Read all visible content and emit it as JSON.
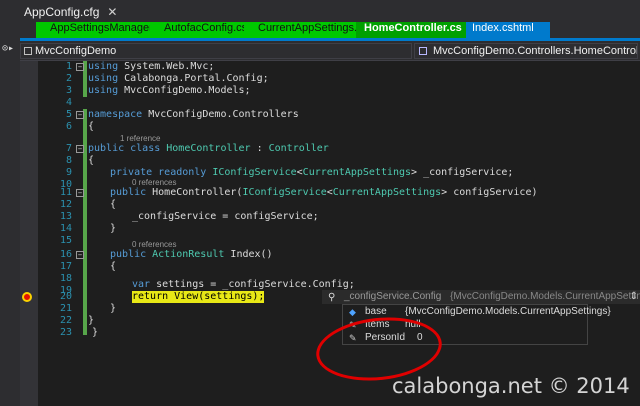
{
  "window": {
    "tab": "AppConfig.cfg",
    "tab_close": "✕"
  },
  "tabs": [
    {
      "label": "AppSettingsManager.cs"
    },
    {
      "label": "AutofacConfig.cs"
    },
    {
      "label": "CurrentAppSettings.cs"
    },
    {
      "label": "HomeController.cs",
      "close": "✕"
    },
    {
      "label": "Index.cshtml"
    }
  ],
  "nav": {
    "project": "MvcConfigDemo",
    "member": "MvcConfigDemo.Controllers.HomeController"
  },
  "code_lines": [
    {
      "n": "1"
    },
    {
      "n": "2"
    },
    {
      "n": "3"
    },
    {
      "n": "4"
    },
    {
      "n": "5"
    },
    {
      "n": "6"
    },
    {
      "n": "7"
    },
    {
      "n": "8"
    },
    {
      "n": "9"
    },
    {
      "n": "10"
    },
    {
      "n": "11"
    },
    {
      "n": "12"
    },
    {
      "n": "13"
    },
    {
      "n": "14"
    },
    {
      "n": "15"
    },
    {
      "n": "16"
    },
    {
      "n": "17"
    },
    {
      "n": "18"
    },
    {
      "n": "19"
    },
    {
      "n": "20"
    },
    {
      "n": "21"
    },
    {
      "n": "22"
    },
    {
      "n": "23"
    }
  ],
  "code": {
    "l1a": "using",
    "l1b": " System.Web.Mvc;",
    "l2a": "using",
    "l2b": " Calabonga.Portal.Config;",
    "l3a": "using",
    "l3b": " MvcConfigDemo.Models;",
    "l5a": "namespace",
    "l5b": " MvcConfigDemo.Controllers",
    "brace_open": "{",
    "brace_close": "}",
    "ref1": "1 reference",
    "l7a": "public class",
    "l7b": " HomeController",
    "l7c": " : ",
    "l7d": "Controller",
    "l9a": "private readonly",
    "l9b": " IConfigService",
    "l9c": "<",
    "l9d": "CurrentAppSettings",
    "l9e": "> _configService;",
    "ref0a": "0 references",
    "l11a": "public",
    "l11b": " HomeController(",
    "l11c": "IConfigService",
    "l11d": "<",
    "l11e": "CurrentAppSettings",
    "l11f": "> configService)",
    "l13": "_configService = configService;",
    "ref0b": "0 references",
    "l16a": "public",
    "l16b": " ActionResult",
    "l16c": " Index()",
    "l18a": "var",
    "l18b": " settings = _configService.Config;",
    "l20a": "return",
    "l20b": " View(settings);"
  },
  "datatip": {
    "expression": "_configService.Config",
    "type": "{MvcConfigDemo.Models.CurrentAppSettings}",
    "close": "⇕",
    "rows": [
      {
        "name": "base",
        "value": "{MvcConfigDemo.Models.CurrentAppSettings}"
      },
      {
        "name": "Items",
        "value": "null"
      },
      {
        "name": "PersonId",
        "value": "0"
      }
    ]
  },
  "watermark": "calabonga.net © 2014"
}
